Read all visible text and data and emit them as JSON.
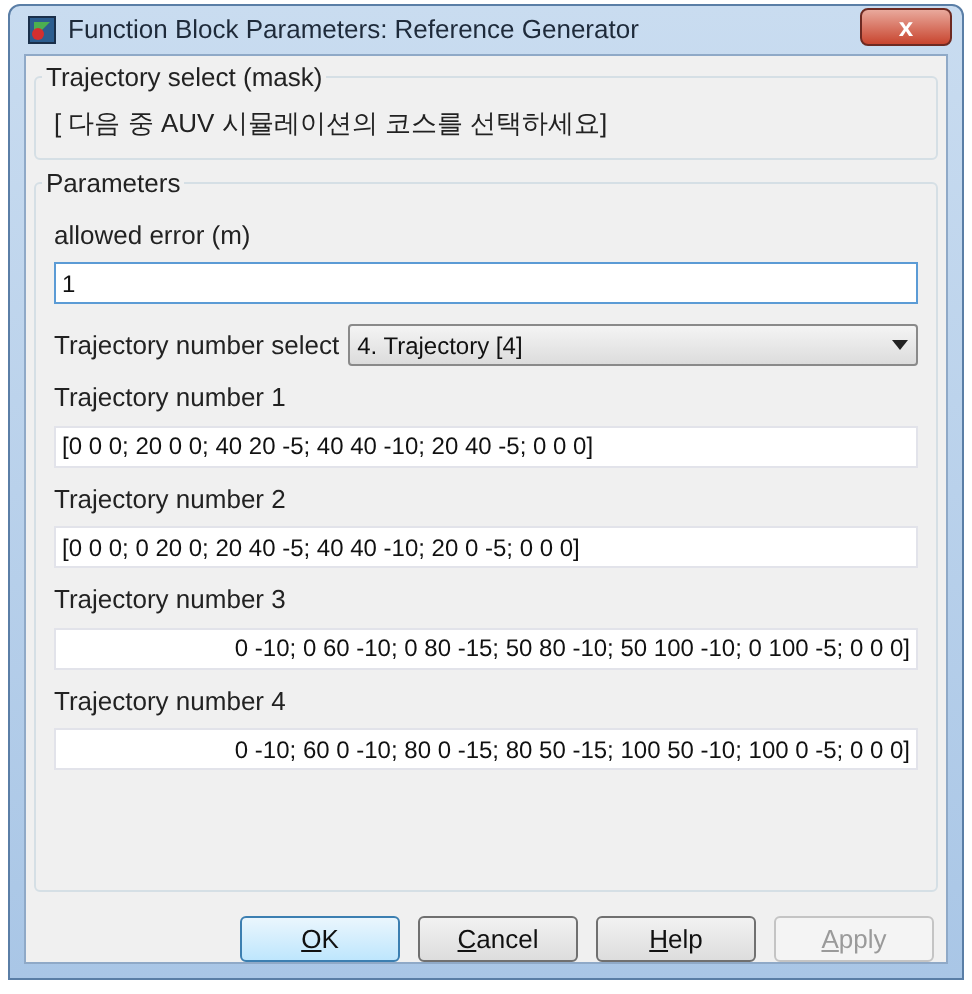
{
  "window": {
    "title": "Function Block Parameters: Reference Generator",
    "close": "x"
  },
  "groups": [
    {
      "title": "Trajectory select (mask)",
      "description": "[ 다음 중 AUV 시뮬레이션의 코스를 선택하세요]"
    },
    {
      "title": "Parameters",
      "fields": [
        {
          "kind": "input",
          "label": "allowed error (m)",
          "value": "1",
          "focused": true
        },
        {
          "kind": "select",
          "label": "Trajectory number select",
          "value": "4. Trajectory [4]"
        },
        {
          "kind": "input",
          "label": "Trajectory number 1",
          "value": "[0 0 0; 20 0 0; 40 20 -5; 40 40 -10; 20 40 -5; 0 0 0]",
          "focused": false,
          "scrolled": false
        },
        {
          "kind": "input",
          "label": "Trajectory number 2",
          "value": "[0 0 0; 0 20 0; 20 40 -5; 40 40 -10; 20 0 -5; 0 0 0]",
          "focused": false,
          "scrolled": false
        },
        {
          "kind": "input",
          "label": "Trajectory number 3",
          "value": "0 -10; 0 60 -10; 0 80 -15; 50 80 -10; 50 100 -10; 0 100 -5; 0 0 0]",
          "focused": false,
          "scrolled": true
        },
        {
          "kind": "input",
          "label": "Trajectory number 4",
          "value": "0 -10; 60 0 -10; 80 0 -15; 80 50 -15; 100 50 -10; 100 0 -5; 0 0 0]",
          "focused": false,
          "scrolled": true
        }
      ]
    }
  ],
  "buttons": [
    {
      "label": "OK",
      "default": true,
      "disabled": false
    },
    {
      "label": "Cancel",
      "default": false,
      "disabled": false
    },
    {
      "label": "Help",
      "default": false,
      "disabled": false
    },
    {
      "label": "Apply",
      "default": false,
      "disabled": true
    }
  ]
}
